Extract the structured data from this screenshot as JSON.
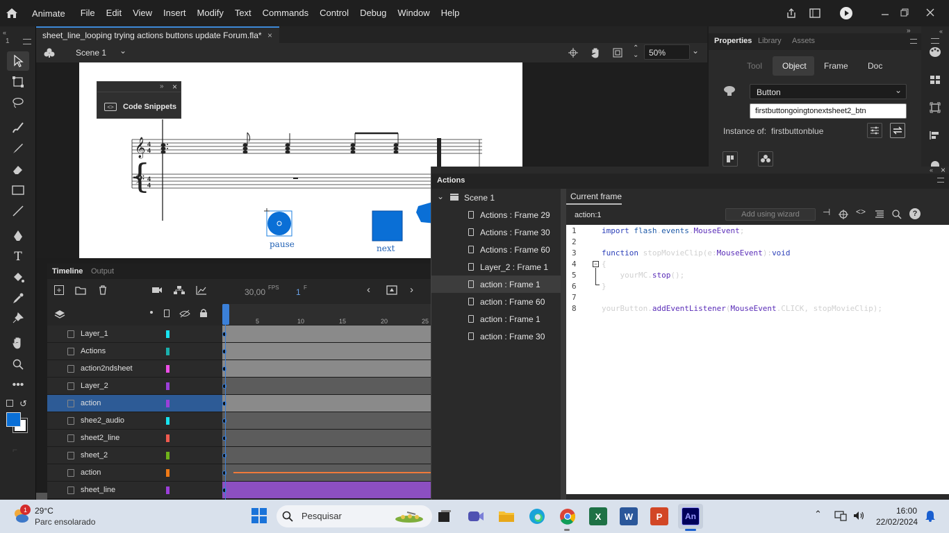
{
  "app": {
    "name": "Animate"
  },
  "menu": [
    "File",
    "Edit",
    "View",
    "Insert",
    "Modify",
    "Text",
    "Commands",
    "Control",
    "Debug",
    "Window",
    "Help"
  ],
  "document": {
    "tab_title": "sheet_line_looping trying actions buttons update Forum.fla*",
    "scene": "Scene 1",
    "zoom": "50%"
  },
  "stage": {
    "snippets_title": "Code Snippets",
    "pause_label": "pause",
    "next_label": "next"
  },
  "timeline": {
    "tab": "Timeline",
    "tab2": "Output",
    "fps": "30,00",
    "fps_unit": "FPS",
    "frame": "1",
    "frame_unit": "F",
    "ruler": [
      "5",
      "10",
      "15",
      "20",
      "25"
    ],
    "layers": [
      {
        "name": "Layer_1",
        "color": "#17e3f0",
        "shade": "#8a8a8a"
      },
      {
        "name": "Actions",
        "color": "#1ab0ad",
        "shade": "#8a8a8a"
      },
      {
        "name": "action2ndsheet",
        "color": "#ee4fe8",
        "shade": "#8a8a8a"
      },
      {
        "name": "Layer_2",
        "color": "#9b3fd9",
        "shade": "#5c5c5c"
      },
      {
        "name": "action",
        "color": "#9b3fd9",
        "shade": "#8a8a8a",
        "selected": true
      },
      {
        "name": "shee2_audio",
        "color": "#17e3f0",
        "shade": "#5c5c5c"
      },
      {
        "name": "sheet2_line",
        "color": "#f05a4f",
        "shade": "#5c5c5c"
      },
      {
        "name": "sheet_2",
        "color": "#6fb21a",
        "shade": "#5c5c5c"
      },
      {
        "name": "action",
        "color": "#f07a16",
        "shade": "#5c5c5c"
      },
      {
        "name": "sheet_line",
        "color": "#9b3fd9",
        "shade": "#8c4fc1"
      }
    ]
  },
  "actions": {
    "title": "Actions",
    "scene": "Scene 1",
    "items": [
      "Actions : Frame 29",
      "Actions : Frame 30",
      "Actions : Frame 60",
      "Layer_2 : Frame 1",
      "action : Frame 1",
      "action : Frame 60",
      "action : Frame 1",
      "action : Frame 30"
    ],
    "current_frame": "Current frame",
    "script_name": "action:1",
    "wizard": "Add using wizard",
    "line_numbers": [
      "1",
      "2",
      "3",
      "4",
      "5",
      "6",
      "7",
      "8"
    ]
  },
  "properties": {
    "tabs": [
      "Properties",
      "Library",
      "Assets"
    ],
    "subtabs": [
      "Tool",
      "Object",
      "Frame",
      "Doc"
    ],
    "symbol_type": "Button",
    "instance_name": "firstbuttongoingtonextsheet2_btn",
    "instance_of_label": "Instance of:",
    "instance_of": "firstbuttonblue"
  },
  "taskbar": {
    "weather_temp": "29°C",
    "weather_desc": "Parc ensolarado",
    "weather_badge": "1",
    "search": "Pesquisar",
    "time": "16:00",
    "date": "22/02/2024"
  }
}
